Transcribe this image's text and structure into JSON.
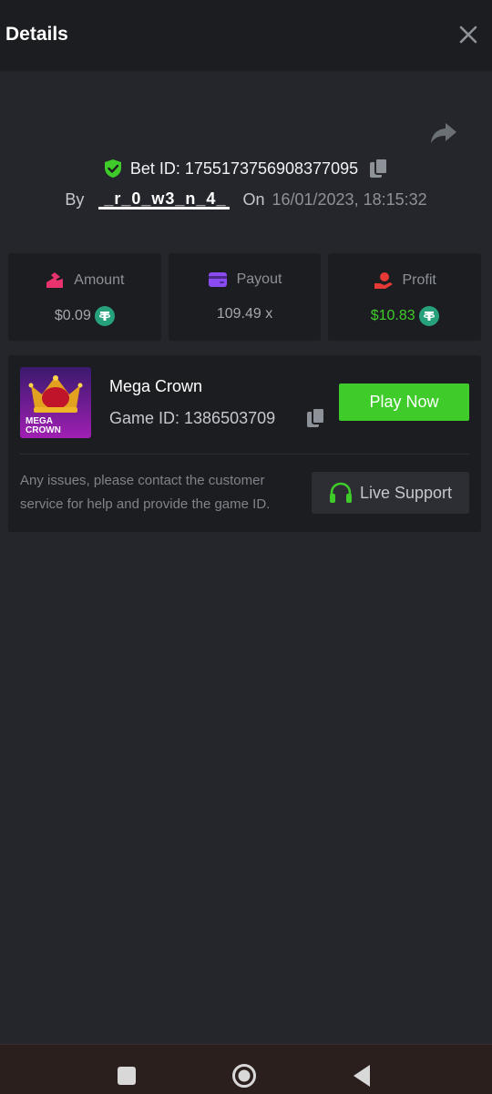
{
  "header": {
    "title": "Details"
  },
  "bet": {
    "id_label": "Bet ID: 1755173756908377095",
    "by_label": "By",
    "username": "_r_0_w3_n_4_",
    "on_label": "On",
    "date": "16/01/2023, 18:15:32"
  },
  "stats": {
    "amount_label": "Amount",
    "amount_value": "$0.09",
    "payout_label": "Payout",
    "payout_value": "109.49 x",
    "profit_label": "Profit",
    "profit_value": "$10.83"
  },
  "game": {
    "name": "Mega Crown",
    "id_label": "Game ID: 1386503709",
    "thumb_text_line1": "MEGA",
    "thumb_text_line2": "CROWN",
    "play_label": "Play Now",
    "note": "Any issues, please contact the customer service for help and provide the game ID.",
    "support_label": "Live Support"
  },
  "colors": {
    "background": "#24262b",
    "panel": "#1c1d21",
    "accent_green": "#3fcc2a",
    "tether_green": "#26a17b",
    "amount_icon": "#e8336e",
    "payout_icon": "#8a4cf0",
    "profit_icon": "#e53935"
  },
  "icons": {
    "close": "close-icon",
    "share": "share-icon",
    "shield": "shield-check-icon",
    "copy": "copy-icon",
    "amount": "amount-icon",
    "payout": "wallet-icon",
    "profit": "profit-hand-icon",
    "currency": "tether-icon",
    "support": "headset-icon"
  }
}
